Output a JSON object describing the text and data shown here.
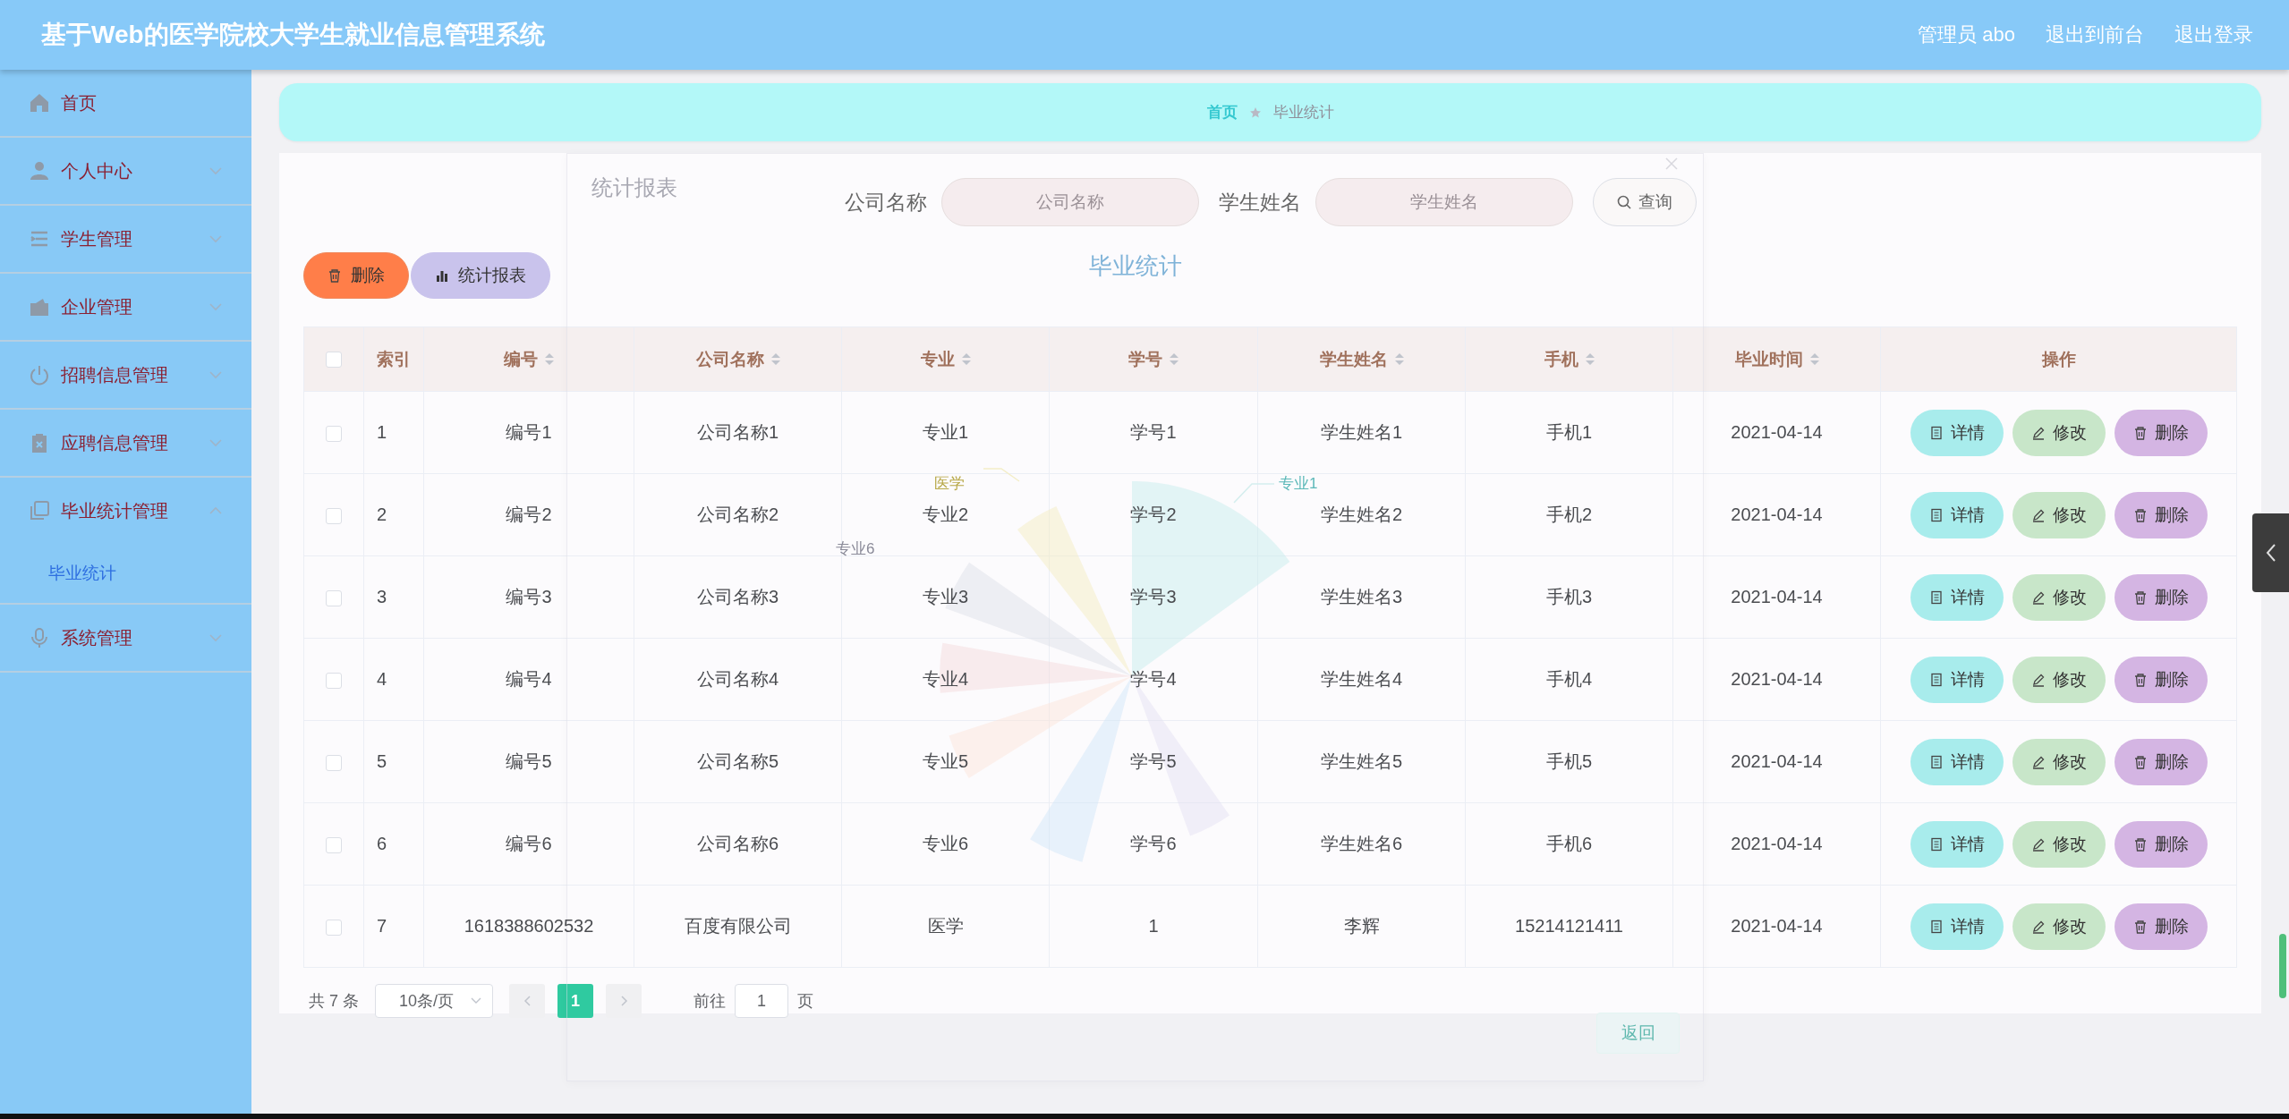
{
  "header": {
    "title": "基于Web的医学院校大学生就业信息管理系统",
    "links": [
      "管理员 abo",
      "退出到前台",
      "退出登录"
    ]
  },
  "sidebar": {
    "items": [
      {
        "label": "首页",
        "kind": "link"
      },
      {
        "label": "个人中心",
        "kind": "menu",
        "expanded": false
      },
      {
        "label": "学生管理",
        "kind": "menu",
        "expanded": false
      },
      {
        "label": "企业管理",
        "kind": "menu",
        "expanded": false
      },
      {
        "label": "招聘信息管理",
        "kind": "menu",
        "expanded": false
      },
      {
        "label": "应聘信息管理",
        "kind": "menu",
        "expanded": false
      },
      {
        "label": "毕业统计管理",
        "kind": "menu",
        "expanded": true,
        "children": [
          {
            "label": "毕业统计",
            "selected": true
          }
        ]
      },
      {
        "label": "系统管理",
        "kind": "menu",
        "expanded": false
      }
    ]
  },
  "breadcrumb": [
    {
      "label": "首页",
      "kind": "link"
    },
    {
      "label": "毕业统计",
      "kind": "current"
    }
  ],
  "search": {
    "fields": [
      {
        "label": "公司名称",
        "placeholder": "公司名称"
      },
      {
        "label": "学生姓名",
        "placeholder": "学生姓名"
      }
    ],
    "button": "查询"
  },
  "actions": [
    {
      "label": "删除",
      "kind": "delete"
    },
    {
      "label": "统计报表",
      "kind": "chart"
    }
  ],
  "table": {
    "select_all": false,
    "columns": [
      {
        "label": "索引",
        "sortable": false
      },
      {
        "label": "编号",
        "sortable": true
      },
      {
        "label": "公司名称",
        "sortable": true
      },
      {
        "label": "专业",
        "sortable": true
      },
      {
        "label": "学号",
        "sortable": true
      },
      {
        "label": "学生姓名",
        "sortable": true
      },
      {
        "label": "手机",
        "sortable": true
      },
      {
        "label": "毕业时间",
        "sortable": true
      },
      {
        "label": "操作",
        "sortable": false
      }
    ],
    "rows": [
      {
        "checked": false,
        "cells": [
          "1",
          "编号1",
          "公司名称1",
          "专业1",
          "学号1",
          "学生姓名1",
          "手机1",
          "2021-04-14"
        ],
        "actions": [
          {
            "label": "详情",
            "kind": "view"
          },
          {
            "label": "修改",
            "kind": "edit"
          },
          {
            "label": "删除",
            "kind": "delete"
          }
        ]
      },
      {
        "checked": false,
        "cells": [
          "2",
          "编号2",
          "公司名称2",
          "专业2",
          "学号2",
          "学生姓名2",
          "手机2",
          "2021-04-14"
        ],
        "actions": [
          {
            "label": "详情",
            "kind": "view"
          },
          {
            "label": "修改",
            "kind": "edit"
          },
          {
            "label": "删除",
            "kind": "delete"
          }
        ]
      },
      {
        "checked": false,
        "cells": [
          "3",
          "编号3",
          "公司名称3",
          "专业3",
          "学号3",
          "学生姓名3",
          "手机3",
          "2021-04-14"
        ],
        "actions": [
          {
            "label": "详情",
            "kind": "view"
          },
          {
            "label": "修改",
            "kind": "edit"
          },
          {
            "label": "删除",
            "kind": "delete"
          }
        ]
      },
      {
        "checked": false,
        "cells": [
          "4",
          "编号4",
          "公司名称4",
          "专业4",
          "学号4",
          "学生姓名4",
          "手机4",
          "2021-04-14"
        ],
        "actions": [
          {
            "label": "详情",
            "kind": "view"
          },
          {
            "label": "修改",
            "kind": "edit"
          },
          {
            "label": "删除",
            "kind": "delete"
          }
        ]
      },
      {
        "checked": false,
        "cells": [
          "5",
          "编号5",
          "公司名称5",
          "专业5",
          "学号5",
          "学生姓名5",
          "手机5",
          "2021-04-14"
        ],
        "actions": [
          {
            "label": "详情",
            "kind": "view"
          },
          {
            "label": "修改",
            "kind": "edit"
          },
          {
            "label": "删除",
            "kind": "delete"
          }
        ]
      },
      {
        "checked": false,
        "cells": [
          "6",
          "编号6",
          "公司名称6",
          "专业6",
          "学号6",
          "学生姓名6",
          "手机6",
          "2021-04-14"
        ],
        "actions": [
          {
            "label": "详情",
            "kind": "view"
          },
          {
            "label": "修改",
            "kind": "edit"
          },
          {
            "label": "删除",
            "kind": "delete"
          }
        ]
      },
      {
        "checked": false,
        "cells": [
          "7",
          "1618388602532",
          "百度有限公司",
          "医学",
          "1",
          "李辉",
          "15214121411",
          "2021-04-14"
        ],
        "actions": [
          {
            "label": "详情",
            "kind": "view"
          },
          {
            "label": "修改",
            "kind": "edit"
          },
          {
            "label": "删除",
            "kind": "delete"
          }
        ]
      }
    ]
  },
  "pagination": {
    "total": "共 7 条",
    "page_size": "10条/页",
    "pages": [
      {
        "label": "1",
        "selected": true
      }
    ],
    "goto_label": "前往",
    "goto_value": "1",
    "goto_suffix": "页"
  },
  "modal": {
    "title": "统计报表",
    "chart_title": "毕业统计",
    "chart_labels": [
      "专业1",
      "医学",
      "专业6"
    ],
    "button": "返回"
  }
}
